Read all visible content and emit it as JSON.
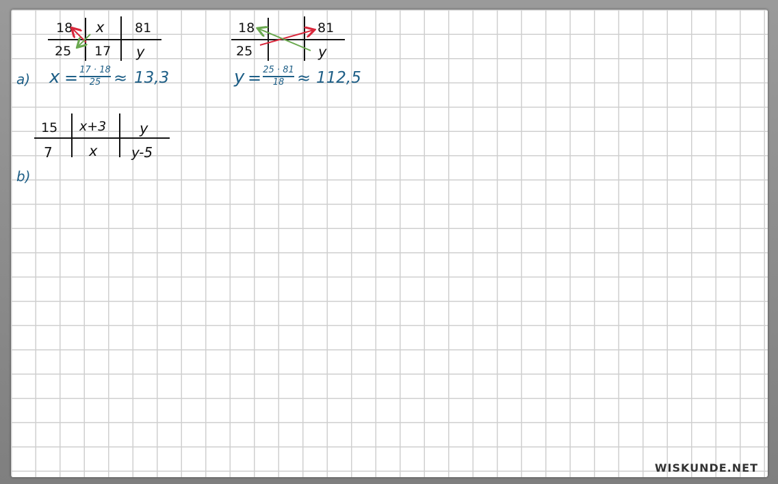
{
  "table1": {
    "top": [
      "18",
      "x",
      "81"
    ],
    "bottom": [
      "25",
      "17",
      "y"
    ]
  },
  "table2": {
    "top": [
      "18",
      "81"
    ],
    "bottom": [
      "25",
      "y"
    ]
  },
  "part_a": {
    "label": "a)",
    "eq1": {
      "lhs": "x",
      "numerator": "17 · 18",
      "denominator": "25",
      "approx": "13,3"
    },
    "eq2": {
      "lhs": "y",
      "numerator": "25 · 81",
      "denominator": "18",
      "approx": "112,5"
    }
  },
  "table3": {
    "top": [
      "15",
      "x+3",
      "y"
    ],
    "bottom": [
      "7",
      "x",
      "y-5"
    ]
  },
  "part_b": {
    "label": "b)"
  },
  "logo": "WISKUNDE.NET",
  "colors": {
    "ink": "#111111",
    "blue": "#1d5e86",
    "red": "#d9283c",
    "green": "#6aa84f",
    "grid": "#cfcfcf"
  }
}
